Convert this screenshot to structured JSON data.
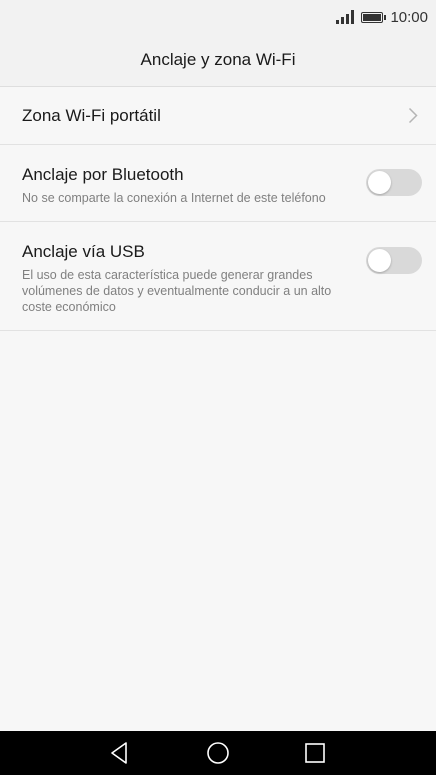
{
  "status_bar": {
    "time": "10:00",
    "icons": [
      "signal-icon",
      "battery-icon"
    ]
  },
  "header": {
    "title": "Anclaje y zona Wi-Fi"
  },
  "settings": {
    "items": [
      {
        "title": "Zona Wi-Fi portátil",
        "icon": "chevron-right-icon"
      },
      {
        "title": "Anclaje por Bluetooth",
        "subtitle": "No se comparte la conexión a Internet de este teléfono",
        "toggle_on": false
      },
      {
        "title": "Anclaje vía USB",
        "subtitle": "El uso de esta característica puede generar grandes volúmenes de datos y eventualmente conducir a un alto coste económico",
        "toggle_on": false
      }
    ]
  },
  "nav_bar": {
    "icons": [
      "back-icon",
      "home-icon",
      "recent-apps-icon"
    ]
  },
  "colors": {
    "background": "#f7f7f7",
    "header_background": "#f2f2f2",
    "toggle_off": "#d9d9d9",
    "nav_bar": "#000000"
  }
}
